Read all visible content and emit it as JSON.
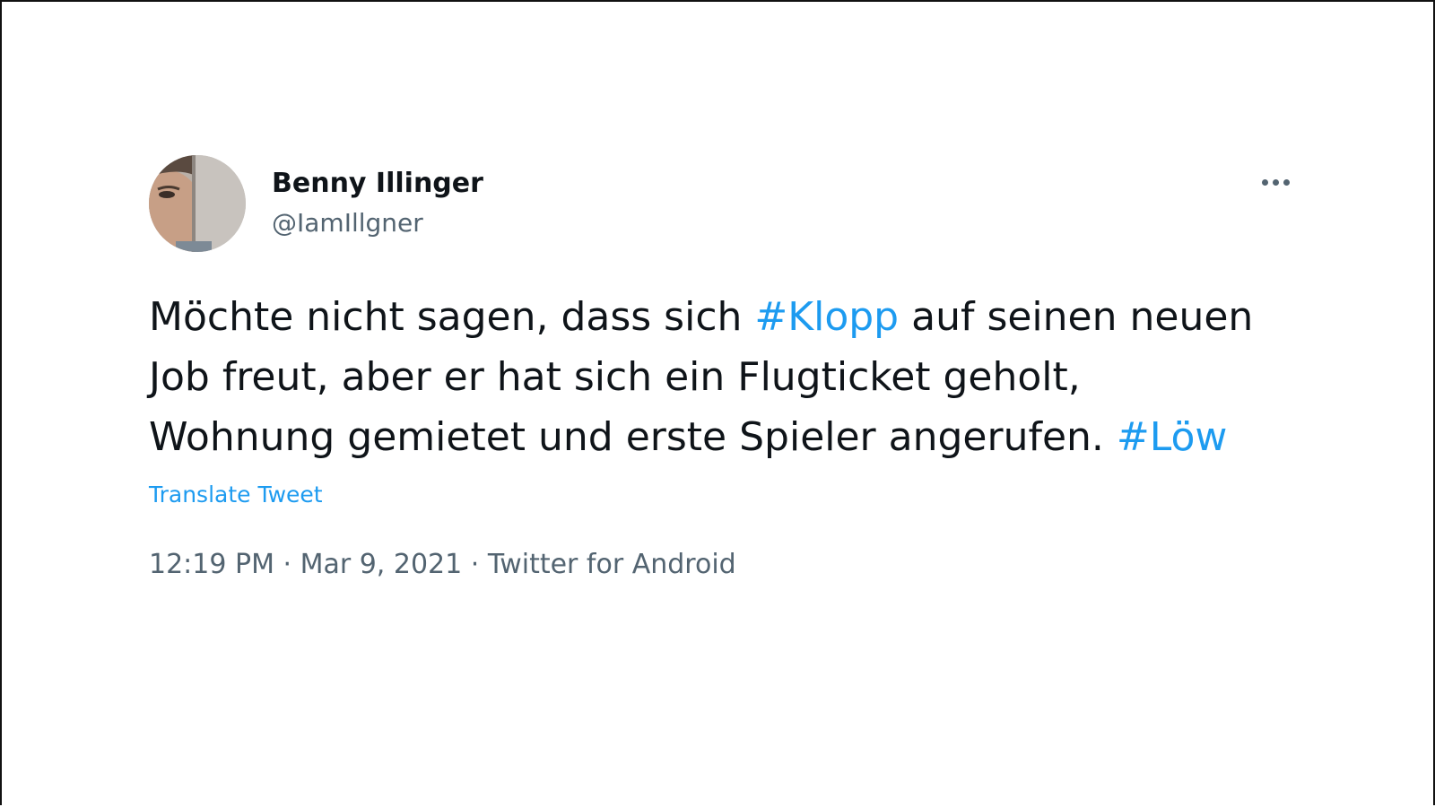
{
  "tweet": {
    "author_name": "Benny Illinger",
    "author_handle": "@IamIllgner",
    "text_line1_a": "Möchte nicht sagen, dass sich ",
    "hashtag_1": "#Klopp",
    "text_line1_b": " auf seinen neuen",
    "text_line2": "Job freut, aber er hat sich ein Flugticket geholt,",
    "text_line3": "Wohnung gemietet und erste Spieler angerufen. ",
    "hashtag_2": "#Löw",
    "translate_label": "Translate Tweet",
    "time": "12:19 PM",
    "separator": " · ",
    "date": "Mar 9, 2021",
    "source": "Twitter for Android"
  },
  "icons": {
    "more": "more-horizontal-icon"
  },
  "colors": {
    "link": "#1d9bf0",
    "secondary_text": "#536471",
    "primary_text": "#0f1419"
  }
}
